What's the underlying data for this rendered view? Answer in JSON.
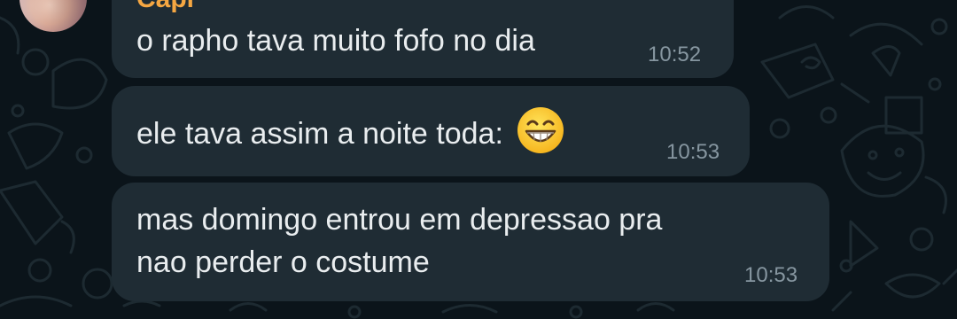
{
  "chat": {
    "sender_name": "Capi",
    "messages": [
      {
        "text": "o rapho tava muito fofo no dia",
        "time": "10:52"
      },
      {
        "text": "ele tava assim a noite toda:",
        "emoji": "grinning-face-with-smiling-eyes-icon",
        "time": "10:53"
      },
      {
        "lines": [
          "mas domingo entrou em depressao pra",
          "nao perder o costume"
        ],
        "time": "10:53"
      }
    ]
  },
  "colors": {
    "background": "#0b141a",
    "bubble": "#1f2c34",
    "sender": "#f5a742",
    "text": "#e9edef",
    "timestamp": "#8696a0"
  }
}
